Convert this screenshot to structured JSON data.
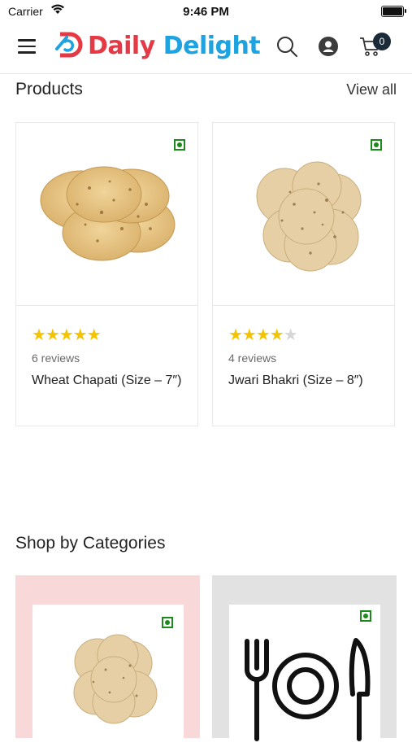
{
  "status_bar": {
    "carrier": "Carrier",
    "time": "9:46 PM"
  },
  "header": {
    "brand_word1": "Daily",
    "brand_word2": "Delight",
    "cart_count": "0",
    "colors": {
      "brand_red": "#e53945",
      "brand_blue": "#1fa3e0",
      "badge": "#1b2a38"
    },
    "icons": [
      "menu-icon",
      "logo-icon",
      "search-icon",
      "account-icon",
      "cart-icon"
    ]
  },
  "products_section": {
    "title": "Products",
    "view_all": "View all",
    "items": [
      {
        "name": "Wheat Chapati (Size – 7″)",
        "reviews": "6 reviews",
        "rating": 5,
        "max_rating": 5,
        "veg": true
      },
      {
        "name": "Jwari Bhakri (Size – 8″)",
        "reviews": "4 reviews",
        "rating": 4,
        "max_rating": 5,
        "veg": true
      }
    ]
  },
  "categories_section": {
    "title": "Shop by Categories",
    "items": [
      {
        "image": "bhakri-stack",
        "background": "#f8d8d8",
        "veg": true
      },
      {
        "image": "cutlery-plate-icon",
        "background": "#e2e2e2",
        "veg": true
      }
    ]
  }
}
